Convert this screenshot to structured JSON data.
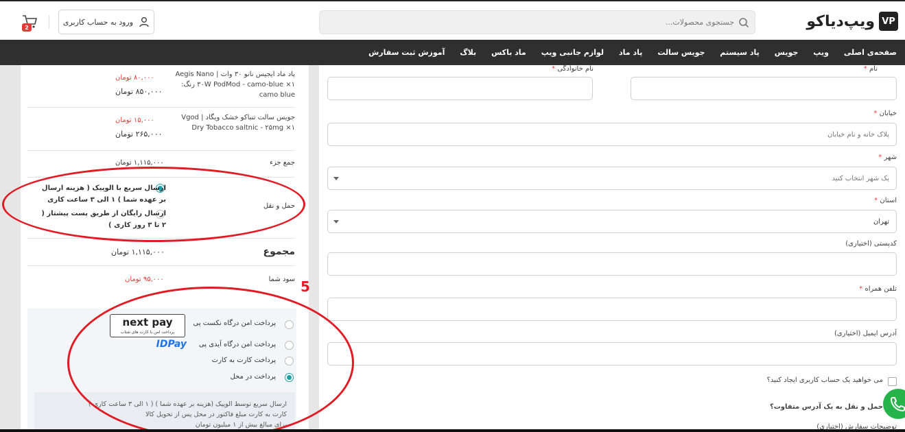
{
  "header": {
    "logo_mark": "VP",
    "logo_text": "ویپ‌دیاکو",
    "search_placeholder": "جستجوی محصولات...",
    "login_label": "ورود به حساب کاربری",
    "cart_count": "2"
  },
  "nav": {
    "items": [
      "صفحه‌ی اصلی",
      "ویپ",
      "جویس",
      "پاد سیستم",
      "جویس سالت",
      "پاد ماد",
      "لوازم جانبی ویپ",
      "ماد باکس",
      "بلاگ",
      "آموزش ثبت سفارش"
    ]
  },
  "form": {
    "first_name_label": "نام",
    "last_name_label": "نام خانوادگی",
    "street_label": "خیابان",
    "street_placeholder": "پلاک خانه و نام خیابان",
    "city_label": "شهر",
    "city_placeholder": "یک شهر انتخاب کنید",
    "province_label": "استان",
    "province_value": "تهران",
    "postcode_label": "کدپستی (اختیاری)",
    "phone_label": "تلفن همراه",
    "email_label": "آدرس ایمیل (اختیاری)",
    "create_account_label": "می خواهید یک حساب کاربری ایجاد کنید؟",
    "ship_different_label": "حمل و نقل به یک آدرس متفاوت؟",
    "order_notes_label": "توضیحات سفارش (اختیاری)",
    "required_mark": "*"
  },
  "summary": {
    "products": [
      {
        "name": "پاد ماد ایجیس نانو ۳۰ وات | Aegis Nano ۳۰W PodMod - camo-blue ×۱ رنگ: camo blue",
        "price_old": "۸۰,۰۰۰ تومان",
        "price": "۸۵۰,۰۰۰ تومان"
      },
      {
        "name": "جویس سالت تنباکو خشک ویگاد | Vgod Dry Tobacco saltnic - ۲۵mg ×۱",
        "price_old": "۱۵,۰۰۰ تومان",
        "price": "۲۶۵,۰۰۰ تومان"
      }
    ],
    "subtotal_label": "جمع جزء",
    "subtotal_value": "۱,۱۱۵,۰۰۰ تومان",
    "shipping_label": "حمل و نقل",
    "shipping_options": [
      "ارسال سریع با الوپیک ( هزینه ارسال بر عهده شما ) ۱ الی ۳ ساعت کاری",
      "ارسال رایگان از طریق پست پیشتاز ( ۲ تا ۳ روز کاری )"
    ],
    "total_label": "مجموع",
    "total_value": "۱,۱۱۵,۰۰۰ تومان",
    "savings_label": "سود شما",
    "savings_value": "۹۵,۰۰۰ تومان"
  },
  "payment": {
    "methods": [
      "پرداخت امن درگاه نکست پی",
      "پرداخت امن درگاه آیدی پی",
      "پرداخت کارت به کارت",
      "پرداخت در محل"
    ],
    "nextpay_logo_text": "next pay",
    "nextpay_logo_sub": "پرداخت امن با کارت های شتاب",
    "idpay_logo_text": "IDPay",
    "description_lines": [
      "ارسال سریع توسط الوپیک (هزینه بر عهده شما ) ( ۱ الی ۳ ساعت کاری )",
      "کارت به کارت مبلغ فاکتور در محل پس از تحویل کالا",
      "برای مبالغ بیش از ۱ میلیون تومان"
    ]
  },
  "annotation": {
    "step_number": "5",
    "color": "#e01b24"
  }
}
